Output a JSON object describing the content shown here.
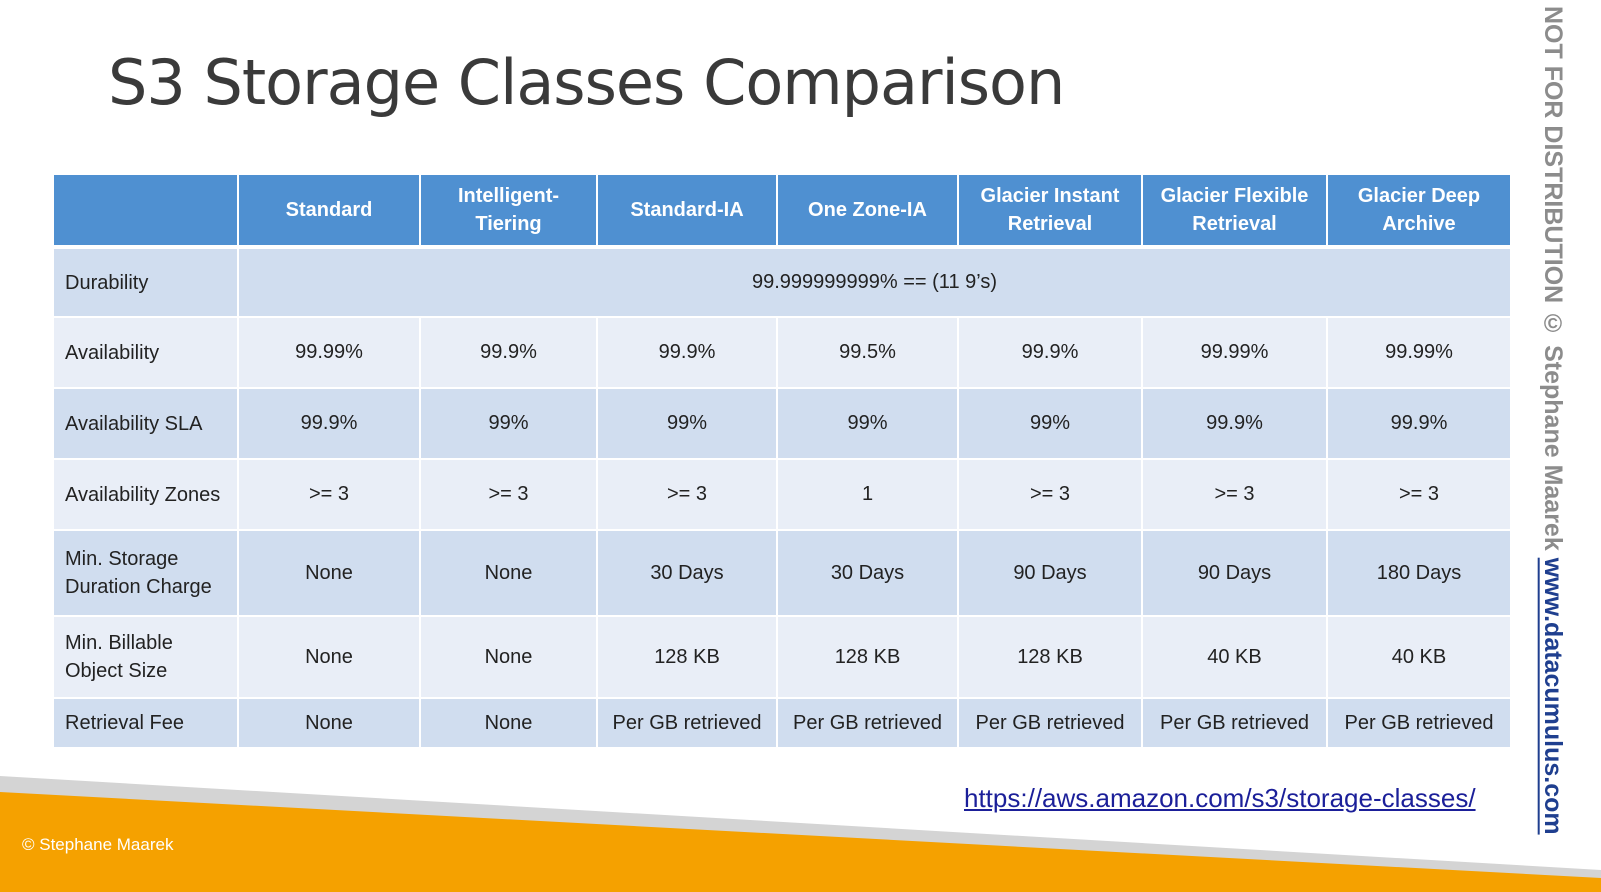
{
  "slide": {
    "title": "S3 Storage Classes Comparison"
  },
  "table": {
    "headers": [
      "",
      "Standard",
      "Intelligent-Tiering",
      "Standard-IA",
      "One Zone-IA",
      "Glacier Instant Retrieval",
      "Glacier Flexible Retrieval",
      "Glacier Deep Archive"
    ],
    "durability": {
      "label": "Durability",
      "value": "99.999999999% == (11 9’s)"
    },
    "rows": [
      {
        "label": "Availability",
        "values": [
          "99.99%",
          "99.9%",
          "99.9%",
          "99.5%",
          "99.9%",
          "99.99%",
          "99.99%"
        ]
      },
      {
        "label": "Availability SLA",
        "values": [
          "99.9%",
          "99%",
          "99%",
          "99%",
          "99%",
          "99.9%",
          "99.9%"
        ]
      },
      {
        "label": "Availability Zones",
        "values": [
          ">= 3",
          ">= 3",
          ">= 3",
          "1",
          ">= 3",
          ">= 3",
          ">= 3"
        ]
      },
      {
        "label": "Min. Storage Duration Charge",
        "values": [
          "None",
          "None",
          "30 Days",
          "30 Days",
          "90 Days",
          "90 Days",
          "180 Days"
        ]
      },
      {
        "label": "Min. Billable Object Size",
        "values": [
          "None",
          "None",
          "128 KB",
          "128 KB",
          "128 KB",
          "40 KB",
          "40 KB"
        ]
      },
      {
        "label": "Retrieval Fee",
        "values": [
          "None",
          "None",
          "Per GB retrieved",
          "Per GB retrieved",
          "Per GB retrieved",
          "Per GB retrieved",
          "Per GB retrieved"
        ]
      }
    ]
  },
  "footer": {
    "copyright": "© Stephane Maarek",
    "link": "https://aws.amazon.com/s3/storage-classes/"
  },
  "side": {
    "notice": "NOT FOR DISTRIBUTION © Stephane Maarek ",
    "site": "www.datacumulus.com"
  },
  "colors": {
    "header": "#4f90d1",
    "row_dark": "#d0ddef",
    "row_light": "#e9eef7",
    "footer_orange": "#f5a100",
    "footer_grey": "#d4d4d4",
    "link": "#1b1f99"
  }
}
